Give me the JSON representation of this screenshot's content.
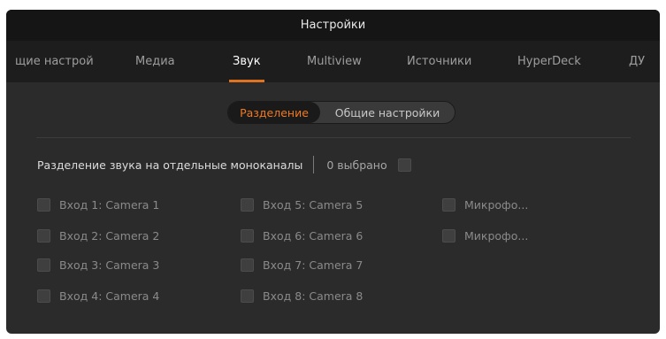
{
  "window": {
    "title": "Настройки"
  },
  "tabs": [
    {
      "label": "щие настрой",
      "active": false
    },
    {
      "label": "Медиа",
      "active": false
    },
    {
      "label": "Звук",
      "active": true
    },
    {
      "label": "Multiview",
      "active": false
    },
    {
      "label": "Источники",
      "active": false
    },
    {
      "label": "HyperDeck",
      "active": false
    },
    {
      "label": "ДУ",
      "active": false
    }
  ],
  "segment": {
    "options": [
      "Разделение",
      "Общие настройки"
    ],
    "selected": "Разделение"
  },
  "split": {
    "label": "Разделение звука на отдельные моноканалы",
    "count_text": "0 выбрано",
    "select_all_checked": false
  },
  "inputs": [
    {
      "label": "Вход 1: Camera 1",
      "checked": false
    },
    {
      "label": "Вход 2: Camera 2",
      "checked": false
    },
    {
      "label": "Вход 3: Camera 3",
      "checked": false
    },
    {
      "label": "Вход 4: Camera 4",
      "checked": false
    },
    {
      "label": "Вход 5: Camera 5",
      "checked": false
    },
    {
      "label": "Вход 6: Camera 6",
      "checked": false
    },
    {
      "label": "Вход 7: Camera 7",
      "checked": false
    },
    {
      "label": "Вход 8: Camera 8",
      "checked": false
    },
    {
      "label": "Микрофо...",
      "checked": false
    },
    {
      "label": "Микрофо...",
      "checked": false
    }
  ],
  "colors": {
    "accent": "#ef7a22",
    "background": "#2b2b2b",
    "titlebar": "#151515"
  }
}
